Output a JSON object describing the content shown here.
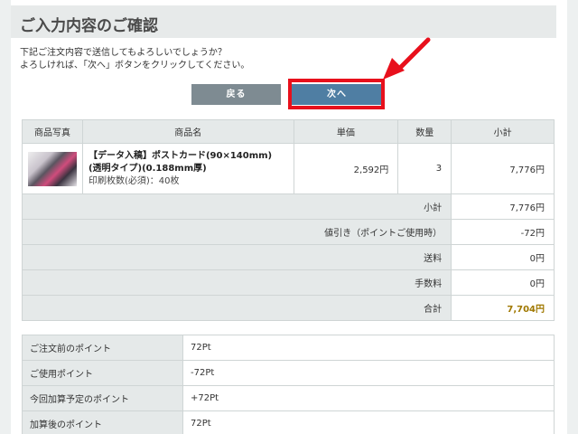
{
  "page": {
    "title": "ご入力内容のご確認",
    "intro_line1": "下記ご注文内容で送信してもよろしいでしょうか？",
    "intro_line2": "よろしければ、「次へ」ボタンをクリックしてください。"
  },
  "buttons": {
    "back_label": "戻る",
    "next_label": "次へ"
  },
  "colors": {
    "highlight": "#e8101c",
    "next_button": "#4f7ea3",
    "back_button": "#7e8b92",
    "total": "#a07800"
  },
  "order_table": {
    "headers": {
      "photo": "商品写真",
      "name": "商品名",
      "unit_price": "単価",
      "quantity": "数量",
      "subtotal": "小計"
    },
    "item": {
      "name_line1": "【データ入稿】ポストカード(90×140mm)",
      "name_line2": "(透明タイプ)(0.188mm厚)",
      "option": "印刷枚数(必須)：40枚",
      "unit_price": "2,592円",
      "quantity": "3",
      "subtotal": "7,776円"
    },
    "summary": [
      {
        "label": "小計",
        "value": "7,776円"
      },
      {
        "label": "値引き（ポイントご使用時）",
        "value": "-72円"
      },
      {
        "label": "送料",
        "value": "0円"
      },
      {
        "label": "手数料",
        "value": "0円"
      },
      {
        "label": "合計",
        "value": "7,704円"
      }
    ]
  },
  "points_table": [
    {
      "label": "ご注文前のポイント",
      "value": "72Pt"
    },
    {
      "label": "ご使用ポイント",
      "value": "-72Pt"
    },
    {
      "label": "今回加算予定のポイント",
      "value": "+72Pt"
    },
    {
      "label": "加算後のポイント",
      "value": "72Pt"
    }
  ]
}
